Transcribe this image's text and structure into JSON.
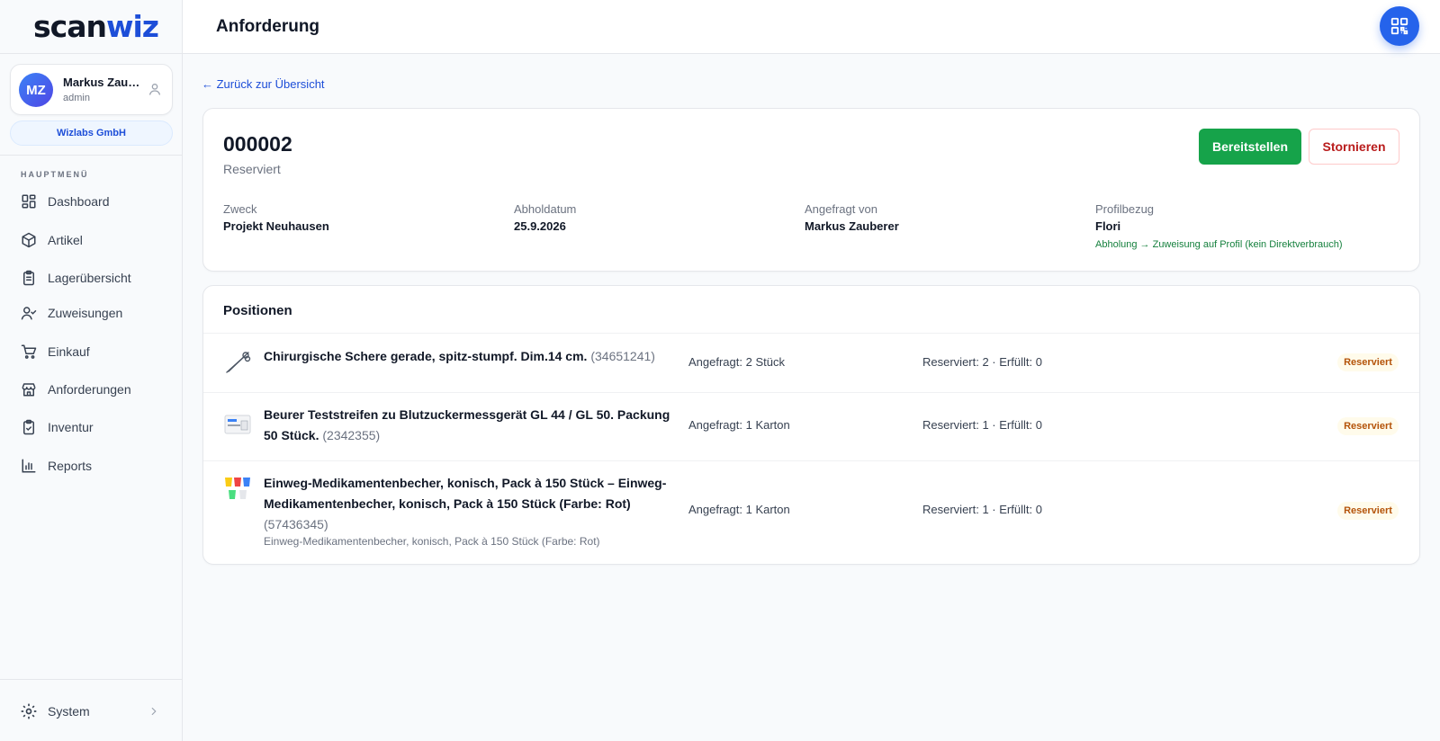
{
  "brand": {
    "part1": "scan",
    "part2": "wiz"
  },
  "user": {
    "initials": "MZ",
    "name": "Markus Zau…",
    "role": "admin"
  },
  "company": "Wizlabs GmbH",
  "menu": {
    "heading": "HAUPTMENÜ",
    "items": [
      {
        "label": "Dashboard",
        "icon": "dashboard-icon"
      },
      {
        "label": "Artikel",
        "icon": "box-icon"
      },
      {
        "label": "Lagerübersicht",
        "icon": "clipboard-list-icon"
      },
      {
        "label": "Zuweisungen",
        "icon": "user-check-icon"
      },
      {
        "label": "Einkauf",
        "icon": "cart-icon"
      },
      {
        "label": "Anforderungen",
        "icon": "store-icon"
      },
      {
        "label": "Inventur",
        "icon": "clipboard-check-icon"
      },
      {
        "label": "Reports",
        "icon": "bar-chart-icon"
      }
    ],
    "system": "System"
  },
  "header": {
    "title": "Anforderung",
    "qr_icon": "qr-code-icon"
  },
  "back_link": "← Zurück zur Übersicht",
  "request": {
    "id": "000002",
    "status": "Reserviert",
    "actions": {
      "provide": "Bereitstellen",
      "cancel": "Stornieren"
    },
    "meta": {
      "purpose_label": "Zweck",
      "purpose": "Projekt Neuhausen",
      "pickup_label": "Abholdatum",
      "pickup": "25.9.2026",
      "requested_by_label": "Angefragt von",
      "requested_by": "Markus Zauberer",
      "profile_label": "Profilbezug",
      "profile": "Flori",
      "profile_note": "Abholung → Zuweisung auf Profil (kein Direktverbrauch)"
    }
  },
  "positions": {
    "title": "Positionen",
    "items": [
      {
        "name": "Chirurgische Schere gerade, spitz-stumpf. Dim.14 cm.",
        "article": "(34651241)",
        "requested": "Angefragt: 2 Stück",
        "reserved": "Reserviert: 2 · Erfüllt: 0",
        "status": "Reserviert"
      },
      {
        "name": "Beurer Teststreifen zu Blutzuckermessgerät GL 44 / GL 50. Packung 50 Stück.",
        "article": "(2342355)",
        "requested": "Angefragt: 1 Karton",
        "reserved": "Reserviert: 1 · Erfüllt: 0",
        "status": "Reserviert"
      },
      {
        "name": "Einweg-Medikamentenbecher, konisch, Pack à 150 Stück – Einweg-Medikamentenbecher, konisch, Pack à 150 Stück (Farbe: Rot)",
        "article": "(57436345)",
        "subtitle": "Einweg-Medikamentenbecher, konisch, Pack à 150 Stück (Farbe: Rot)",
        "requested": "Angefragt: 1 Karton",
        "reserved": "Reserviert: 1 · Erfüllt: 0",
        "status": "Reserviert"
      }
    ]
  },
  "colors": {
    "primary": "#2563eb",
    "success": "#16a34a",
    "danger": "#b91c1c",
    "warning": "#b45309"
  }
}
